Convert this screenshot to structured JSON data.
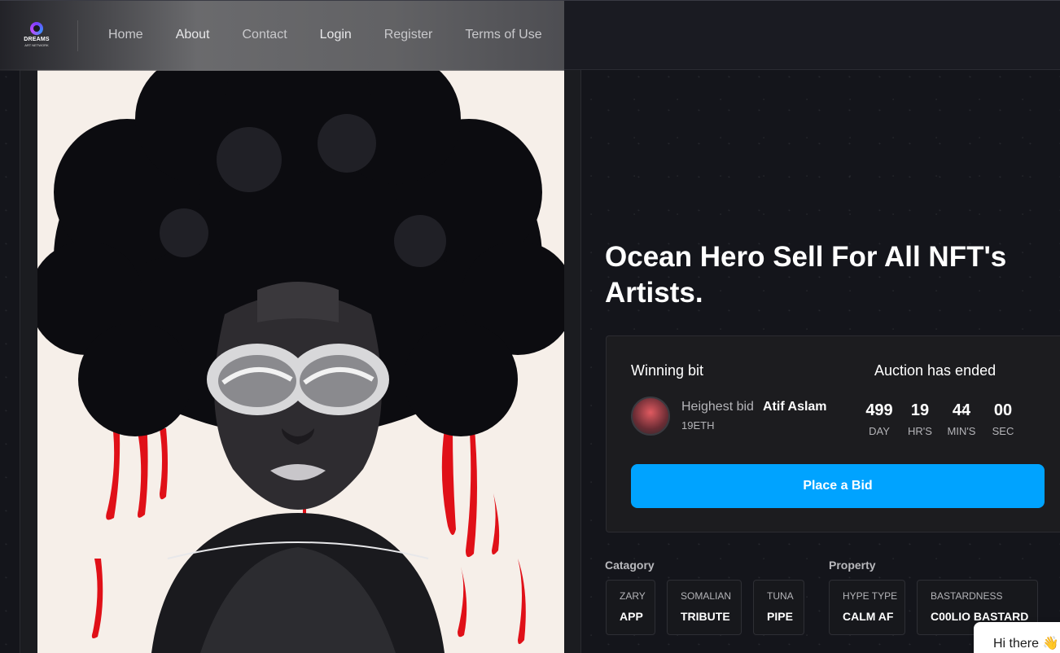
{
  "brand": {
    "name": "DREAMS",
    "tagline": "ART NETWORK"
  },
  "nav": {
    "items": [
      {
        "label": "Home"
      },
      {
        "label": "About"
      },
      {
        "label": "Contact"
      },
      {
        "label": "Login"
      },
      {
        "label": "Register"
      },
      {
        "label": "Terms of Use"
      }
    ]
  },
  "hero": {
    "title": "Ocean Hero Sell For All NFT's Artists."
  },
  "auction": {
    "winning_label": "Winning bit",
    "status_label": "Auction has ended",
    "highest_bid_label": "Heighest bid",
    "bidder_name": "Atif Aslam",
    "bid_amount": "19ETH",
    "countdown": {
      "days": "499",
      "hours": "19",
      "minutes": "44",
      "seconds": "00",
      "days_label": "DAY",
      "hours_label": "HR'S",
      "minutes_label": "MIN'S",
      "seconds_label": "SEC",
      "separator": ":"
    },
    "place_bid_label": "Place a Bid"
  },
  "category": {
    "label": "Catagory",
    "tags": [
      {
        "key": "ZARY",
        "value": "APP"
      },
      {
        "key": "SOMALIAN",
        "value": "TRIBUTE"
      },
      {
        "key": "TUNA",
        "value": "PIPE"
      }
    ]
  },
  "property": {
    "label": "Property",
    "tags": [
      {
        "key": "HYPE TYPE",
        "value": "CALM AF"
      },
      {
        "key": "BASTARDNESS",
        "value": "C00LIO BASTARD"
      }
    ]
  },
  "chat_widget": {
    "text": "Hi there 👋"
  },
  "colors": {
    "accent": "#00a3ff",
    "background": "#14151b",
    "panel": "#1c1c1f"
  }
}
